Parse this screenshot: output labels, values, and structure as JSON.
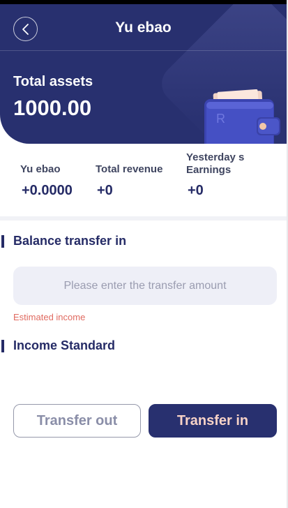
{
  "header": {
    "title": "Yu ebao",
    "assets_label": "Total assets",
    "assets_value": "1000.00"
  },
  "stats": {
    "items": [
      {
        "label": "Yu ebao",
        "value": "+0.0000"
      },
      {
        "label": "Total revenue",
        "value": "+0"
      },
      {
        "label_line1": "Yesterday s",
        "label_line2": "Earnings",
        "value": "+0"
      }
    ]
  },
  "transfer": {
    "section_title": "Balance transfer in",
    "input_placeholder": "Please enter the transfer amount",
    "input_value": "",
    "estimated_label": "Estimated income"
  },
  "income": {
    "section_title": "Income Standard"
  },
  "actions": {
    "transfer_out_label": "Transfer out",
    "transfer_in_label": "Transfer in"
  },
  "icons": {
    "back": "chevron-left-icon",
    "wallet": "wallet-icon"
  },
  "colors": {
    "primary": "#28306f",
    "accent_text": "#f7d2c7",
    "warning": "#e06a60",
    "input_bg": "#eeeff7"
  }
}
